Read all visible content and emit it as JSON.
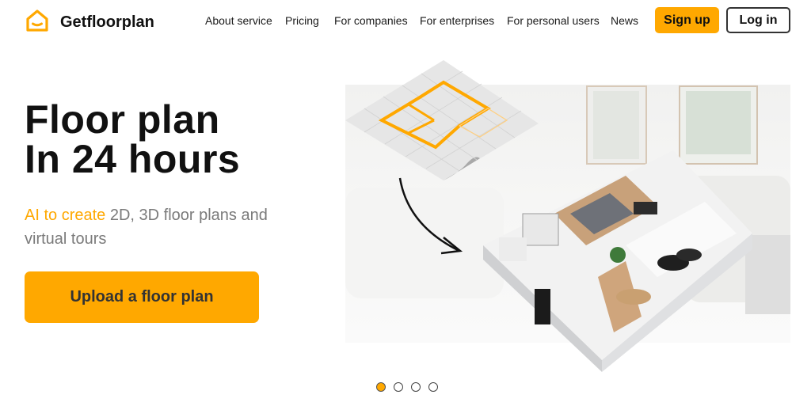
{
  "brand": {
    "name": "Getfloorplan",
    "logo_icon": "house-smile-icon",
    "accent_color": "#ffa800"
  },
  "nav": {
    "items": [
      {
        "label": "About service"
      },
      {
        "label": "Pricing"
      },
      {
        "label": "For companies"
      },
      {
        "label": "For enterprises"
      },
      {
        "label": "For personal users"
      },
      {
        "label": "News"
      }
    ],
    "signup_label": "Sign up",
    "login_label": "Log in"
  },
  "hero": {
    "title_line1": "Floor plan",
    "title_line2": "In 24 hours",
    "subtitle_accent": "AI to create",
    "subtitle_rest": " 2D, 3D floor plans and virtual tours",
    "cta_label": "Upload a floor plan",
    "image_alt": "2D floor plan sheet transformed into a 3D furnished apartment model"
  },
  "carousel": {
    "slide_count": 4,
    "active_index": 0
  }
}
